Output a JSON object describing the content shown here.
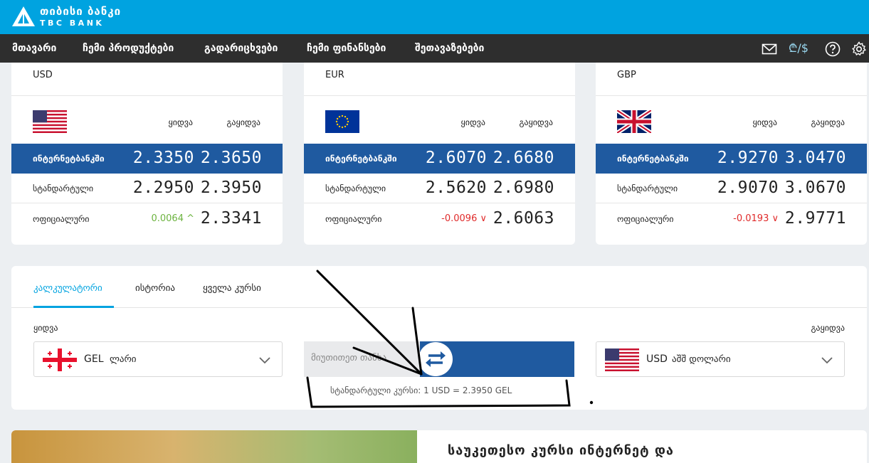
{
  "brand": {
    "name_ka": "თიბისი ბანკი",
    "name_en": "TBC BANK"
  },
  "nav": {
    "items": [
      "მთავარი",
      "ჩემი პროდუქტები",
      "გადარიცხვები",
      "ჩემი ფინანსები",
      "შეთავაზებები"
    ],
    "currency_toggle": "₾/$",
    "icons": [
      "mail-icon",
      "currency-icon",
      "help-icon",
      "settings-icon"
    ]
  },
  "rates": {
    "buy_label": "ყიდვა",
    "sell_label": "გაყიდვა",
    "row_labels": {
      "internet": "ინტერნეტბანკში",
      "standard": "სტანდარტული",
      "official": "ოფიციალური"
    },
    "cards": [
      {
        "code": "USD",
        "flag": "us-flag",
        "internet": [
          "2.3350",
          "2.3650"
        ],
        "standard": [
          "2.2950",
          "2.3950"
        ],
        "official_change": "0.0064 ^",
        "official_direction": "up",
        "official": "2.3341"
      },
      {
        "code": "EUR",
        "flag": "eu-flag",
        "internet": [
          "2.6070",
          "2.6680"
        ],
        "standard": [
          "2.5620",
          "2.6980"
        ],
        "official_change": "-0.0096 ∨",
        "official_direction": "down",
        "official": "2.6063"
      },
      {
        "code": "GBP",
        "flag": "uk-flag",
        "internet": [
          "2.9270",
          "3.0470"
        ],
        "standard": [
          "2.9070",
          "3.0670"
        ],
        "official_change": "-0.0193 ∨",
        "official_direction": "down",
        "official": "2.9771"
      }
    ]
  },
  "calculator": {
    "tabs": [
      "კალკულატორი",
      "ისტორია",
      "ყველა კურსი"
    ],
    "active_tab": 0,
    "buy_label": "ყიდვა",
    "sell_label": "გაყიდვა",
    "from": {
      "code": "GEL",
      "name": "ლარი",
      "flag": "ge-flag"
    },
    "to": {
      "code": "USD",
      "name": "აშშ დოლარი",
      "flag": "us-flag"
    },
    "amount_placeholder": "მიუთითეთ თანხა",
    "rate_note": "სტანდარტული კურსი:  1 USD = 2.3950 GEL"
  },
  "promo": {
    "title": "საუკეთესო კურსი ინტერნეტ და"
  },
  "colors": {
    "brand_blue": "#00a3e0",
    "highlight_blue": "#1f5aa0",
    "nav_dark": "#2e2e2e",
    "up_green": "#6cb33f",
    "down_red": "#e02a2a"
  }
}
